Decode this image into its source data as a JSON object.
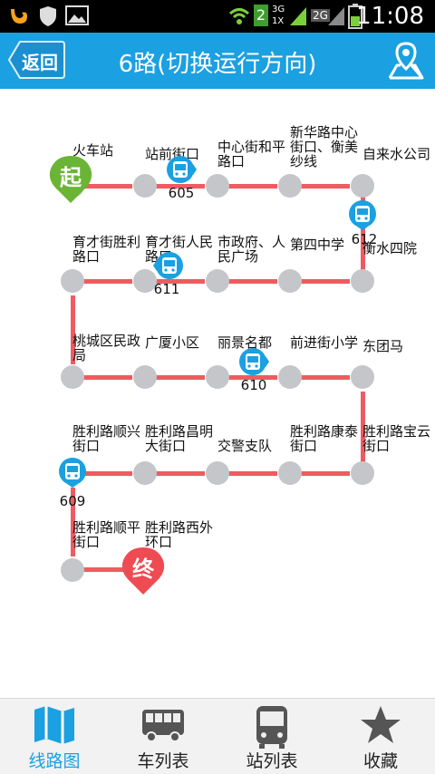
{
  "status_bar": {
    "time": "11:08",
    "sim_badge": "2",
    "net1": "3G 1X",
    "net2": "2G"
  },
  "header": {
    "back_label": "返回",
    "title": "6路(切换运行方向)"
  },
  "stations": [
    {
      "name": "火车站"
    },
    {
      "name": "站前街口"
    },
    {
      "name": "中心街和平\n路口"
    },
    {
      "name": "新华路中心\n街口、衡美\n纱线"
    },
    {
      "name": "自来水公司"
    },
    {
      "name": "育才街胜利\n路口"
    },
    {
      "name": "育才街人民\n路口"
    },
    {
      "name": "市政府、人\n民广场"
    },
    {
      "name": "第四中学"
    },
    {
      "name": "衡水四院"
    },
    {
      "name": "桃城区民政\n局"
    },
    {
      "name": "广厦小区"
    },
    {
      "name": "丽景名都"
    },
    {
      "name": "前进街小学"
    },
    {
      "name": "东团马"
    },
    {
      "name": "胜利路顺兴\n街口"
    },
    {
      "name": "胜利路昌明\n大街口"
    },
    {
      "name": "交警支队"
    },
    {
      "name": "胜利路康泰\n街口"
    },
    {
      "name": "胜利路宝云\n街口"
    },
    {
      "name": "胜利路顺平\n街口"
    },
    {
      "name": "胜利路西外\n环口"
    }
  ],
  "buses": [
    "605",
    "612",
    "611",
    "610",
    "609"
  ],
  "markers": {
    "start": "起",
    "end": "终"
  },
  "tabs": [
    {
      "label": "线路图"
    },
    {
      "label": "车列表"
    },
    {
      "label": "站列表"
    },
    {
      "label": "收藏"
    }
  ],
  "colors": {
    "accent": "#1ba0e1",
    "route_line": "#ef5b60",
    "station": "#c4c6ca",
    "start_pin": "#6ab536",
    "end_pin": "#ef4b52"
  }
}
